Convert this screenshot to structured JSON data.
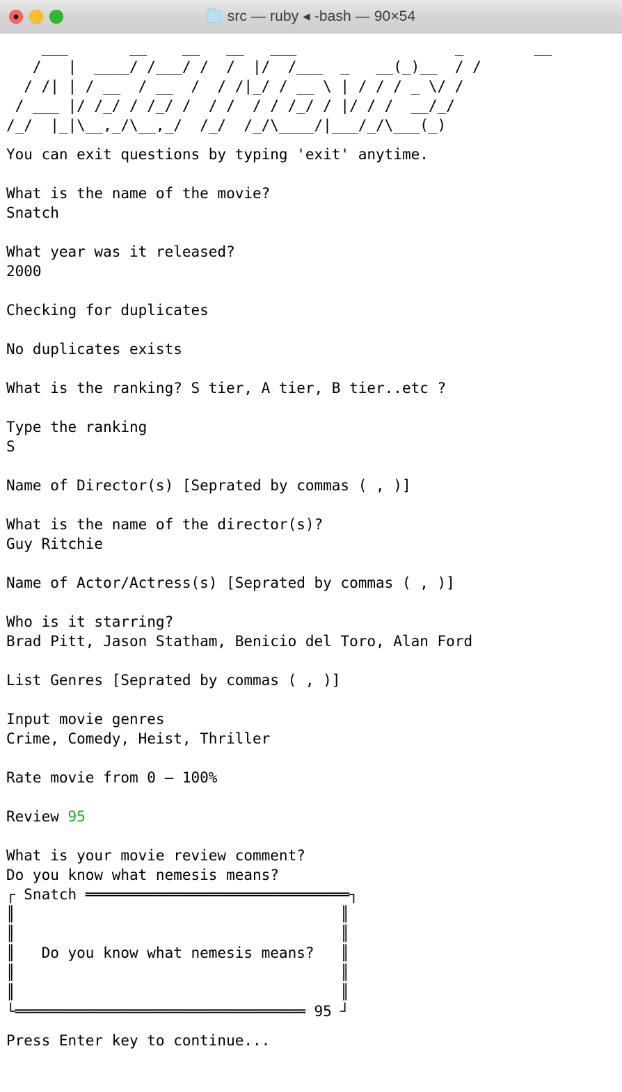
{
  "window": {
    "title": "src — ruby ◂ -bash — 90×54",
    "folder_icon": "folder-icon",
    "traffic_lights": [
      {
        "name": "close-button",
        "color": "#ff6159"
      },
      {
        "name": "minimize-button",
        "color": "#ffbd2e"
      },
      {
        "name": "maximize-button",
        "color": "#2eb82e"
      }
    ]
  },
  "colors": {
    "prompt_blue": "#4d3df0",
    "success_green": "#22a822",
    "text_black": "#000000",
    "background": "#ffffff"
  },
  "terminal": {
    "banner": [
      "    ___       __    __   __   ___                  _        __ ",
      "   /   |  ____/ /___/ /  /  |/  /___  _   __(_)__  / / ",
      "  / /| | / __  / __  /  / /|_/ / __ \\ | / / / _ \\/ /  ",
      " / ___ |/ /_/ / /_/ /  / /  / / /_/ / |/ / /  __/_/   ",
      "/_/  |_|\\__,_/\\__,_/  /_/  /_/\\____/|___/_/\\___(_)   "
    ],
    "lines": [
      {
        "id": "exit-hint",
        "color": "blue",
        "text": "You can exit questions by typing 'exit' anytime."
      },
      {
        "id": "question-movie-name",
        "color": "blue",
        "text": "What is the name of the movie?"
      },
      {
        "id": "answer-movie-name",
        "color": "black",
        "text": "Snatch"
      },
      {
        "id": "question-year",
        "color": "blue",
        "text": "What year was it released?"
      },
      {
        "id": "answer-year",
        "color": "black",
        "text": "2000"
      },
      {
        "id": "status-checking",
        "color": "blue",
        "text": "Checking for duplicates"
      },
      {
        "id": "status-no-duplicates",
        "color": "green",
        "text": "No duplicates exists"
      },
      {
        "id": "question-ranking",
        "color": "blue",
        "text": "What is the ranking? S tier, A tier, B tier..etc ?"
      },
      {
        "id": "prompt-type-ranking",
        "color": "blue",
        "text": "Type the ranking"
      },
      {
        "id": "answer-ranking",
        "color": "black",
        "text": "S"
      },
      {
        "id": "label-director",
        "color": "blue",
        "text": "Name of Director(s) [Seprated by commas ( , )]"
      },
      {
        "id": "question-director",
        "color": "blue",
        "text": "What is the name of the director(s)?"
      },
      {
        "id": "answer-director",
        "color": "black",
        "text": "Guy Ritchie"
      },
      {
        "id": "label-actors",
        "color": "blue",
        "text": "Name of Actor/Actress(s) [Seprated by commas ( , )]"
      },
      {
        "id": "question-starring",
        "color": "blue",
        "text": "Who is it starring?"
      },
      {
        "id": "answer-starring",
        "color": "black",
        "text": "Brad Pitt, Jason Statham, Benicio del Toro, Alan Ford"
      },
      {
        "id": "label-genres",
        "color": "blue",
        "text": "List Genres [Seprated by commas ( , )]"
      },
      {
        "id": "prompt-input-genres",
        "color": "blue",
        "text": "Input movie genres"
      },
      {
        "id": "answer-genres",
        "color": "black",
        "text": "Crime, Comedy, Heist, Thriller"
      },
      {
        "id": "label-rate",
        "color": "blue",
        "text": "Rate movie from 0 — 100%"
      }
    ],
    "review_line": {
      "label": "Review ",
      "value": "95"
    },
    "comment": {
      "question": "What is your movie review comment?",
      "answer": "Do you know what nemesis means?"
    },
    "review_box": {
      "title": "Snatch",
      "body": "Do you know what nemesis means?",
      "footer_value": "95"
    },
    "footer": "Press Enter key to continue..."
  }
}
